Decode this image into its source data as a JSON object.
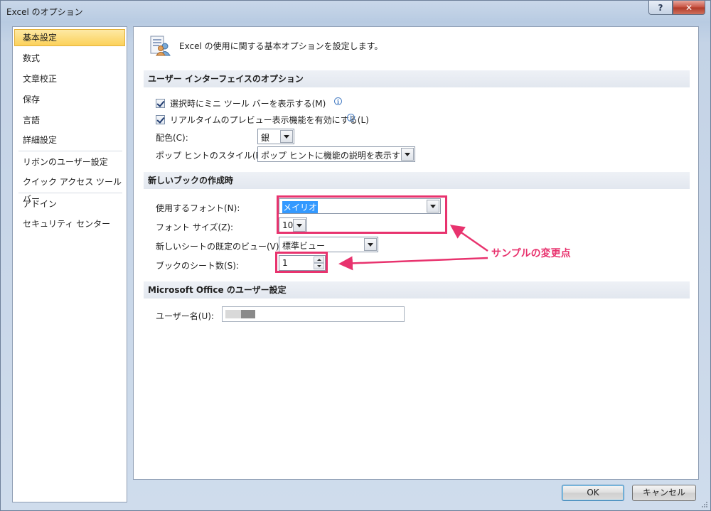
{
  "window": {
    "title": "Excel のオプション",
    "help_label": "?",
    "close_label": "✕"
  },
  "sidebar": {
    "items": [
      {
        "label": "基本設定",
        "selected": true
      },
      {
        "label": "数式"
      },
      {
        "label": "文章校正"
      },
      {
        "label": "保存"
      },
      {
        "label": "言語"
      },
      {
        "label": "詳細設定"
      },
      {
        "label": "リボンのユーザー設定"
      },
      {
        "label": "クイック アクセス ツール バー"
      },
      {
        "label": "アドイン"
      },
      {
        "label": "セキュリティ センター"
      }
    ]
  },
  "main": {
    "header": "Excel の使用に関する基本オプションを設定します。",
    "ui_section": {
      "title": "ユーザー インターフェイスのオプション",
      "mini_toolbar": {
        "label": "選択時にミニ ツール バーを表示する(M)",
        "checked": true
      },
      "live_preview": {
        "label": "リアルタイムのプレビュー表示機能を有効にする(L)",
        "checked": true
      },
      "color_label": "配色(C):",
      "color_value": "銀",
      "screentip_label": "ポップ ヒントのスタイル(R):",
      "screentip_value": "ポップ ヒントに機能の説明を表示する"
    },
    "new_book_section": {
      "title": "新しいブックの作成時",
      "font_label": "使用するフォント(N):",
      "font_value": "メイリオ",
      "font_size_label": "フォント サイズ(Z):",
      "font_size_value": "10",
      "default_view_label": "新しいシートの既定のビュー(V):",
      "default_view_value": "標準ビュー",
      "sheet_count_label": "ブックのシート数(S):",
      "sheet_count_value": "1"
    },
    "user_section": {
      "title": "Microsoft Office のユーザー設定",
      "username_label": "ユーザー名(U):"
    },
    "annotation": "サンプルの変更点"
  },
  "footer": {
    "ok_label": "OK",
    "cancel_label": "キャンセル"
  },
  "colors": {
    "annotation": "#e8336e",
    "selection": "#fcd15a"
  }
}
